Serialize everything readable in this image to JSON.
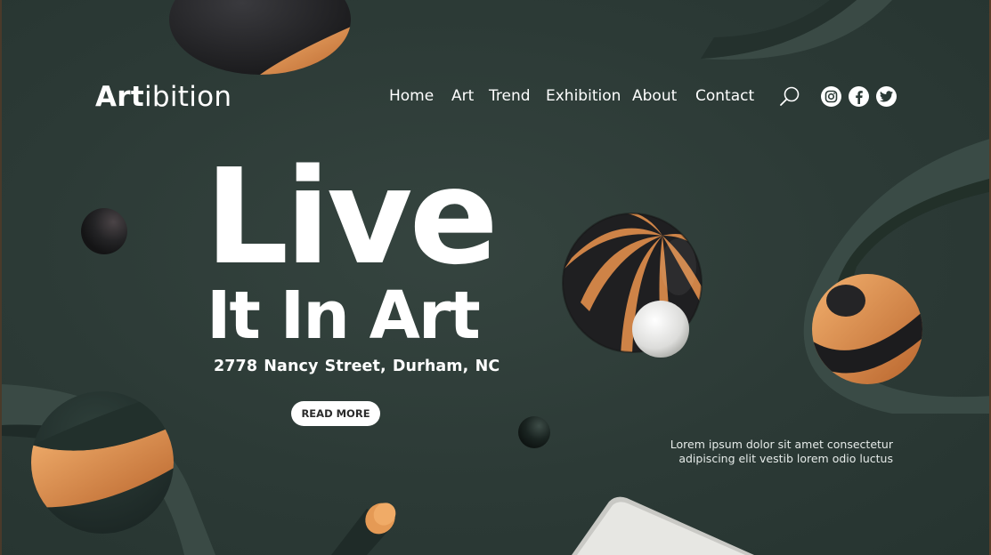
{
  "brand": {
    "logo_bold": "Art",
    "logo_light": "ibition"
  },
  "nav": {
    "items": [
      {
        "label": "Home"
      },
      {
        "label": "Art"
      },
      {
        "label": "Trend"
      },
      {
        "label": "Exhibition"
      },
      {
        "label": "About"
      },
      {
        "label": "Contact"
      }
    ]
  },
  "header_icons": {
    "search": "search-icon",
    "social": [
      "instagram-icon",
      "facebook-icon",
      "twitter-icon"
    ]
  },
  "hero": {
    "title_line1": "Live",
    "title_line2": "It In Art",
    "address": "2778  Nancy Street, Durham, NC",
    "cta_label": "READ MORE"
  },
  "footer_text": {
    "line1": "Lorem ipsum dolor sit amet consectetur",
    "line2": "adipiscing elit vestib lorem odio luctus"
  },
  "colors": {
    "background": "#2b3a36",
    "accent_orange": "#d98a4a",
    "sphere_dark": "#2a2a2c",
    "text": "#ffffff"
  }
}
